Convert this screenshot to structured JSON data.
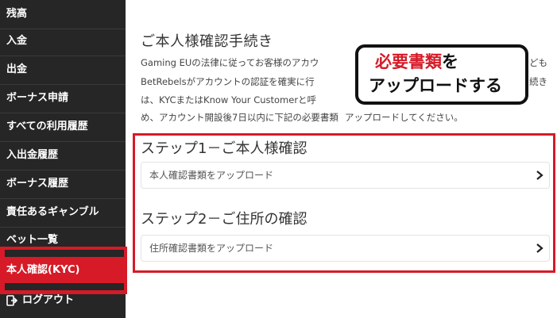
{
  "sidebar": {
    "items": [
      {
        "label": "残高"
      },
      {
        "label": "入金"
      },
      {
        "label": "出金"
      },
      {
        "label": "ボーナス申請"
      },
      {
        "label": "すべての利用履歴"
      },
      {
        "label": "入出金履歴"
      },
      {
        "label": "ボーナス履歴"
      },
      {
        "label": "責任あるギャンブル"
      },
      {
        "label": "ベット一覧"
      }
    ],
    "active_label": "本人確認(KYC)",
    "logout_label": "ログアウト"
  },
  "main": {
    "title": "ご本人様確認手続き",
    "description": [
      "Gaming EUの法律に従ってお客様のアカウ",
      "BetRebelsがアカウントの認証を確実に行",
      "は、KYCまたはKnow Your Customerと呼",
      "め、アカウント開設後7日以内に下記の必要書類",
      "アップロードしてください。"
    ],
    "desc_tail": [
      "ども",
      "続き"
    ],
    "steps": [
      {
        "title": "ステップ1－ご本人様確認",
        "upload_label": "本人確認書類をアップロード"
      },
      {
        "title": "ステップ2－ご住所の確認",
        "upload_label": "住所確認書類をアップロード"
      }
    ]
  },
  "callout": {
    "line1_red": "必要書類",
    "line1_rest": "を",
    "line2": "アップロードする"
  },
  "colors": {
    "sidebar_bg": "#262626",
    "accent_red": "#d61a27"
  }
}
